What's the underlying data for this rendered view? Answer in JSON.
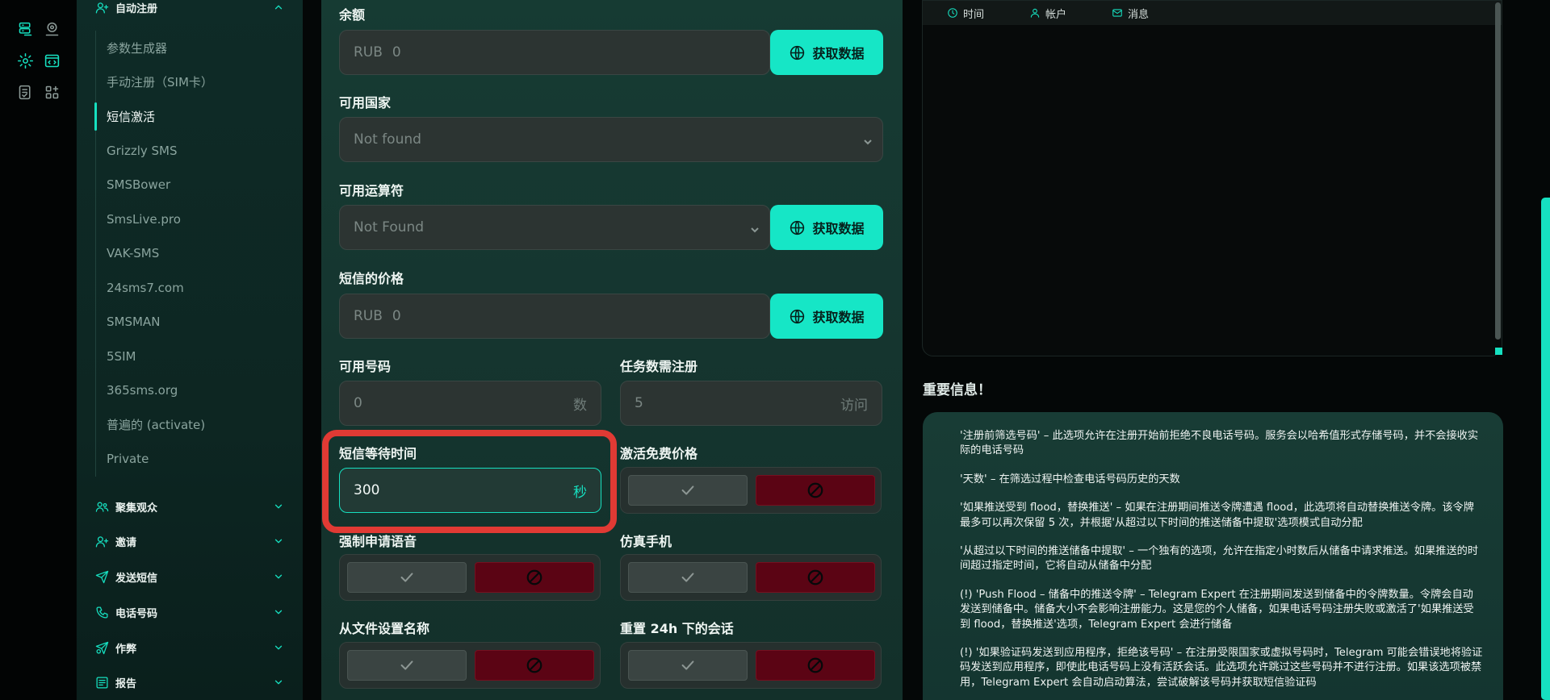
{
  "colors": {
    "accent": "#16e0c0",
    "danger": "#5b0414",
    "highlight": "#e03a34"
  },
  "rail": {
    "icons": [
      "database-icon",
      "location-icon",
      "gear-icon",
      "code-window-icon",
      "checklist-icon",
      "grid-icon"
    ]
  },
  "sidebar": {
    "open_section": {
      "label": "自动注册",
      "icon": "user-plus-icon",
      "items": [
        {
          "label": "参数生成器"
        },
        {
          "label": "手动注册（SIM卡）"
        },
        {
          "label": "短信激活",
          "active": true
        },
        {
          "label": "Grizzly SMS"
        },
        {
          "label": "SMSBower"
        },
        {
          "label": "SmsLive.pro"
        },
        {
          "label": "VAK-SMS"
        },
        {
          "label": "24sms7.com"
        },
        {
          "label": "SMSMAN"
        },
        {
          "label": "5SIM"
        },
        {
          "label": "365sms.org"
        },
        {
          "label": "普遍的 (activate)"
        },
        {
          "label": "Private"
        }
      ]
    },
    "sections": [
      {
        "label": "聚集观众",
        "icon": "users-icon"
      },
      {
        "label": "邀请",
        "icon": "user-add-icon"
      },
      {
        "label": "发送短信",
        "icon": "send-icon"
      },
      {
        "label": "电话号码",
        "icon": "phone-icon"
      },
      {
        "label": "作弊",
        "icon": "cheat-icon"
      },
      {
        "label": "报告",
        "icon": "report-icon"
      }
    ]
  },
  "form": {
    "balance": {
      "label": "余额",
      "prefix": "RUB",
      "value": "0",
      "button": "获取数据"
    },
    "countries": {
      "label": "可用国家",
      "value": "Not found"
    },
    "operators": {
      "label": "可用运算符",
      "value": "Not Found",
      "button": "获取数据"
    },
    "price": {
      "label": "短信的价格",
      "prefix": "RUB",
      "value": "0",
      "button": "获取数据"
    },
    "available_numbers": {
      "label": "可用号码",
      "value": "0",
      "suffix": "数"
    },
    "task_count": {
      "label": "任务数需注册",
      "value": "5",
      "suffix": "访问"
    },
    "wait_time": {
      "label": "短信等待时间",
      "value": "300",
      "suffix": "秒"
    },
    "free_price": {
      "label": "激活免费价格"
    },
    "force_voice": {
      "label": "强制申请语音"
    },
    "emulate_phone": {
      "label": "仿真手机"
    },
    "name_from_file": {
      "label": "从文件设置名称"
    },
    "reset_sessions": {
      "label": "重置 24h 下的会话"
    }
  },
  "log": {
    "tabs": [
      {
        "label": "时间",
        "icon": "clock-icon"
      },
      {
        "label": "帐户",
        "icon": "user-icon"
      },
      {
        "label": "消息",
        "icon": "mail-icon"
      }
    ]
  },
  "info": {
    "title": "重要信息！",
    "paragraphs": [
      "'注册前筛选号码' – 此选项允许在注册开始前拒绝不良电话号码。服务会以哈希值形式存储号码，并不会接收实际的电话号码",
      "'天数' – 在筛选过程中检查电话号码历史的天数",
      "'如果推送受到 flood，替换推送' – 如果在注册期间推送令牌遭遇 flood，此选项将自动替换推送令牌。该令牌最多可以再次保留 5 次，并根据'从超过以下时间的推送储备中提取'选项模式自动分配",
      "'从超过以下时间的推送储备中提取' – 一个独有的选项，允许在指定小时数后从储备中请求推送。如果推送的时间超过指定时间，它将自动从储备中分配",
      "(!) 'Push Flood – 储备中的推送令牌' – Telegram Expert 在注册期间发送到储备中的令牌数量。令牌会自动发送到储备中。储备大小不会影响注册能力。这是您的个人储备，如果电话号码注册失败或激活了'如果推送受到 flood，替换推送'选项，Telegram Expert 会进行储备",
      "(!) '如果验证码发送到应用程序，拒绝该号码' – 在注册受限国家或虚拟号码时，Telegram 可能会错误地将验证码发送到应用程序，即使此电话号码上没有活跃会话。此选项允许跳过这些号码并不进行注册。如果该选项被禁用，Telegram Expert 会自动启动算法，尝试破解该号码并获取短信验证码"
    ]
  }
}
